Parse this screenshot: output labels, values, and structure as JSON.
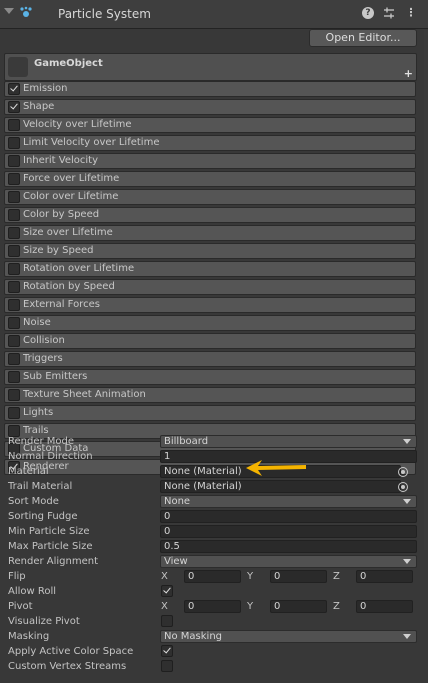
{
  "header": {
    "title": "Particle System",
    "icons": [
      "help-icon",
      "presets-icon",
      "menu-icon"
    ]
  },
  "toolbar": {
    "open_editor_label": "Open Editor..."
  },
  "game_object": {
    "name": "GameObject"
  },
  "modules": [
    {
      "label": "Emission",
      "enabled": true
    },
    {
      "label": "Shape",
      "enabled": true
    },
    {
      "label": "Velocity over Lifetime",
      "enabled": false
    },
    {
      "label": "Limit Velocity over Lifetime",
      "enabled": false
    },
    {
      "label": "Inherit Velocity",
      "enabled": false
    },
    {
      "label": "Force over Lifetime",
      "enabled": false
    },
    {
      "label": "Color over Lifetime",
      "enabled": false
    },
    {
      "label": "Color by Speed",
      "enabled": false
    },
    {
      "label": "Size over Lifetime",
      "enabled": false
    },
    {
      "label": "Size by Speed",
      "enabled": false
    },
    {
      "label": "Rotation over Lifetime",
      "enabled": false
    },
    {
      "label": "Rotation by Speed",
      "enabled": false
    },
    {
      "label": "External Forces",
      "enabled": false
    },
    {
      "label": "Noise",
      "enabled": false
    },
    {
      "label": "Collision",
      "enabled": false
    },
    {
      "label": "Triggers",
      "enabled": false
    },
    {
      "label": "Sub Emitters",
      "enabled": false
    },
    {
      "label": "Texture Sheet Animation",
      "enabled": false
    },
    {
      "label": "Lights",
      "enabled": false
    },
    {
      "label": "Trails",
      "enabled": false
    },
    {
      "label": "Custom Data",
      "enabled": false
    },
    {
      "label": "Renderer",
      "enabled": true
    }
  ],
  "renderer": {
    "render_mode": {
      "label": "Render Mode",
      "value": "Billboard"
    },
    "normal_direction": {
      "label": "Normal Direction",
      "value": "1"
    },
    "material": {
      "label": "Material",
      "value": "None (Material)"
    },
    "trail_material": {
      "label": "Trail Material",
      "value": "None (Material)"
    },
    "sort_mode": {
      "label": "Sort Mode",
      "value": "None"
    },
    "sorting_fudge": {
      "label": "Sorting Fudge",
      "value": "0"
    },
    "min_particle_size": {
      "label": "Min Particle Size",
      "value": "0"
    },
    "max_particle_size": {
      "label": "Max Particle Size",
      "value": "0.5"
    },
    "render_alignment": {
      "label": "Render Alignment",
      "value": "View"
    },
    "flip": {
      "label": "Flip",
      "x_label": "X",
      "x": "0",
      "y_label": "Y",
      "y": "0",
      "z_label": "Z",
      "z": "0"
    },
    "allow_roll": {
      "label": "Allow Roll",
      "checked": true
    },
    "pivot": {
      "label": "Pivot",
      "x_label": "X",
      "x": "0",
      "y_label": "Y",
      "y": "0",
      "z_label": "Z",
      "z": "0"
    },
    "visualize_pivot": {
      "label": "Visualize Pivot",
      "checked": false
    },
    "masking": {
      "label": "Masking",
      "value": "No Masking"
    },
    "apply_active_color_space": {
      "label": "Apply Active Color Space",
      "checked": true
    },
    "custom_vertex_streams": {
      "label": "Custom Vertex Streams",
      "checked": false
    }
  },
  "colors": {
    "annotation_arrow": "#f5b400",
    "background": "#383838"
  }
}
